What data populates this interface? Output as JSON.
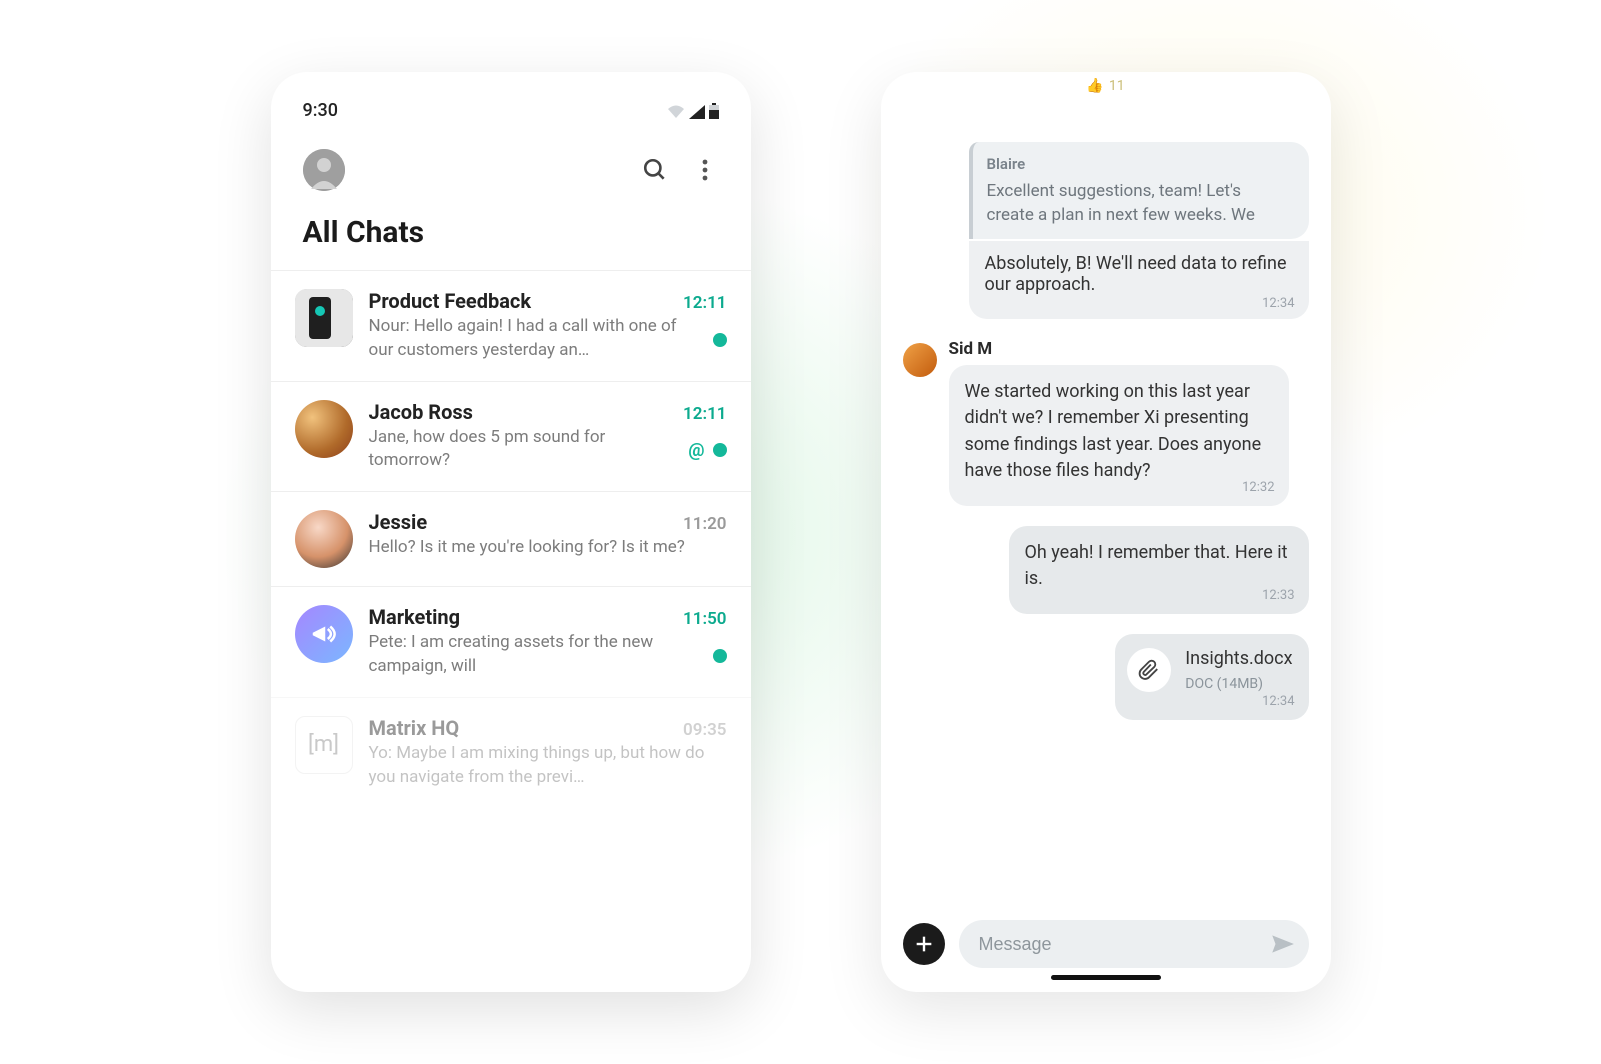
{
  "left": {
    "status_time": "9:30",
    "page_title": "All Chats",
    "chats": [
      {
        "name": "Product Feedback",
        "time": "12:11",
        "time_accent": true,
        "preview": "Nour: Hello again! I had a call with one of our customers yesterday an…",
        "unread": true,
        "mention": false
      },
      {
        "name": "Jacob Ross",
        "time": "12:11",
        "time_accent": true,
        "preview": "Jane, how does 5 pm sound for tomorrow?",
        "unread": true,
        "mention": true
      },
      {
        "name": "Jessie",
        "time": "11:20",
        "time_accent": false,
        "preview": "Hello? Is it me you're looking for? Is it me?",
        "unread": false,
        "mention": false
      },
      {
        "name": "Marketing",
        "time": "11:50",
        "time_accent": true,
        "preview": "Pete: I am creating assets for the new campaign, will",
        "unread": true,
        "mention": false
      },
      {
        "name": "Matrix HQ",
        "time": "09:35",
        "time_accent": false,
        "preview": "Yo: Maybe I am mixing things up, but how do you navigate from the previ…",
        "unread": false,
        "mention": false
      }
    ]
  },
  "right": {
    "reaction_count": "11",
    "reply_block": {
      "quote_sender": "Blaire",
      "quote_text": "Excellent suggestions, team! Let's create a plan in next few weeks. We",
      "reply_text": "Absolutely, B! We'll need data to refine our approach.",
      "reply_time": "12:34"
    },
    "incoming": {
      "sender": "Sid M",
      "text": "We started working on this last year didn't we? I remember Xi presenting some findings last year. Does anyone have those files handy?",
      "time": "12:32"
    },
    "outgoing1": {
      "text": "Oh yeah! I remember that. Here it is.",
      "time": "12:33"
    },
    "file": {
      "name": "Insights.docx",
      "meta": "DOC (14MB)",
      "time": "12:34"
    },
    "composer_placeholder": "Message"
  }
}
